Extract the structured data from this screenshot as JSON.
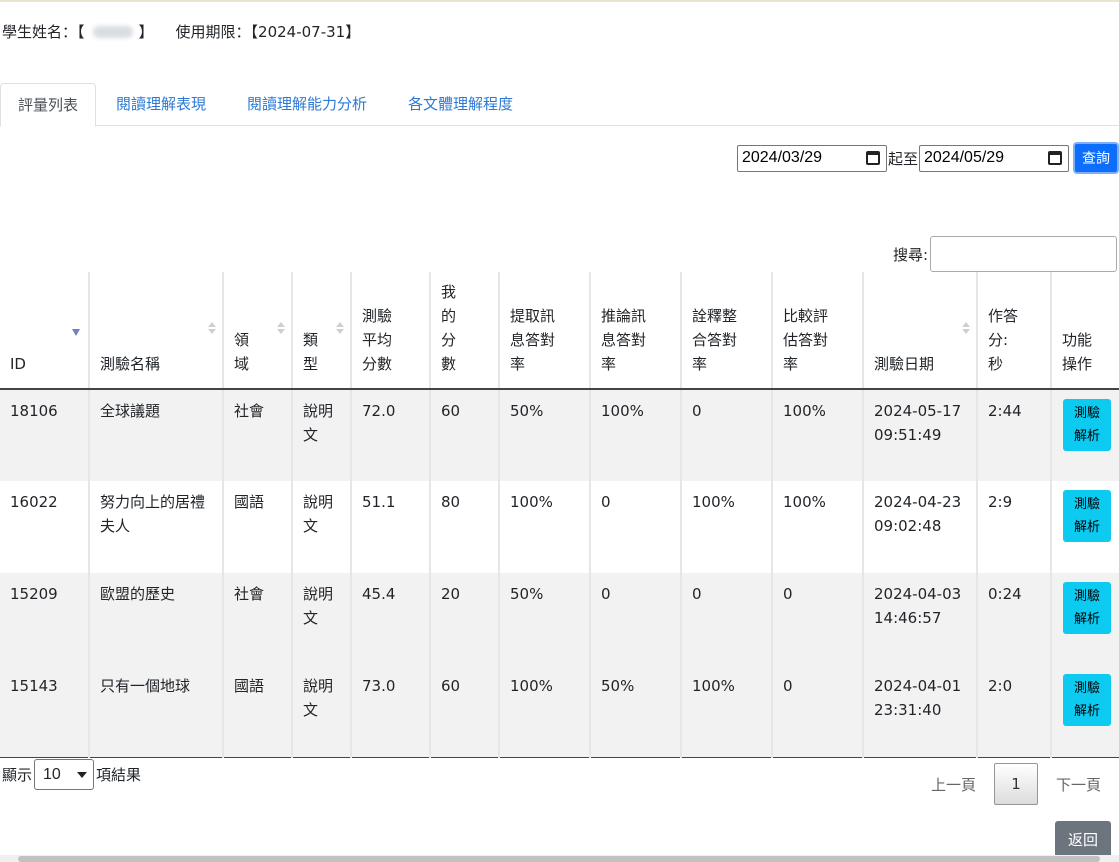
{
  "student": {
    "name_label": "學生姓名：【",
    "name_close": "】",
    "period_label": "使用期限：【2024-07-31】"
  },
  "tabs": [
    {
      "label": "評量列表",
      "active": true
    },
    {
      "label": "閱讀理解表現"
    },
    {
      "label": "閱讀理解能力分析"
    },
    {
      "label": "各文體理解程度"
    }
  ],
  "filter": {
    "start_date": "2024/03/29",
    "separator": "起至",
    "end_date": "2024/05/29",
    "query_label": "查詢"
  },
  "search": {
    "label": "搜尋:"
  },
  "table": {
    "headers": {
      "id": [
        "ID"
      ],
      "name": [
        "測驗名稱"
      ],
      "domain": [
        "領",
        "域"
      ],
      "type": [
        "類",
        "型"
      ],
      "avg": [
        "測驗",
        "平均",
        "分數"
      ],
      "my": [
        "我",
        "的",
        "分",
        "數"
      ],
      "extract": [
        "提取訊",
        "息答對",
        "率"
      ],
      "infer": [
        "推論訊",
        "息答對",
        "率"
      ],
      "interpret": [
        "詮釋整",
        "合答對",
        "率"
      ],
      "evaluate": [
        "比較評",
        "估答對",
        "率"
      ],
      "date": [
        "測驗日期"
      ],
      "time": [
        "作答",
        "分:",
        "秒"
      ],
      "action": [
        "功能",
        "操作"
      ]
    },
    "rows": [
      {
        "id": "18106",
        "name": [
          "全球議題"
        ],
        "domain": "社會",
        "type": [
          "說明",
          "文"
        ],
        "avg": "72.0",
        "my": "60",
        "extract": "50%",
        "infer": "100%",
        "interpret": "0",
        "evaluate": "100%",
        "date": [
          "2024-05-17",
          "09:51:49"
        ],
        "time": "2:44",
        "action": [
          "測驗",
          "解析"
        ]
      },
      {
        "id": "16022",
        "name": [
          "努力向上的居禮",
          "夫人"
        ],
        "domain": "國語",
        "type": [
          "說明",
          "文"
        ],
        "avg": "51.1",
        "my": "80",
        "extract": "100%",
        "infer": "0",
        "interpret": "100%",
        "evaluate": "100%",
        "date": [
          "2024-04-23",
          "09:02:48"
        ],
        "time": "2:9",
        "action": [
          "測驗",
          "解析"
        ]
      },
      {
        "id": "15209",
        "name": [
          "歐盟的歷史"
        ],
        "domain": "社會",
        "type": [
          "說明",
          "文"
        ],
        "avg": "45.4",
        "my": "20",
        "extract": "50%",
        "infer": "0",
        "interpret": "0",
        "evaluate": "0",
        "date": [
          "2024-04-03",
          "14:46:57"
        ],
        "time": "0:24",
        "action": [
          "測驗",
          "解析"
        ]
      },
      {
        "id": "15143",
        "name": [
          "只有一個地球"
        ],
        "domain": "國語",
        "type": [
          "說明",
          "文"
        ],
        "avg": "73.0",
        "my": "60",
        "extract": "100%",
        "infer": "50%",
        "interpret": "100%",
        "evaluate": "0",
        "date": [
          "2024-04-01",
          "23:31:40"
        ],
        "time": "2:0",
        "action": [
          "測驗",
          "解析"
        ]
      }
    ]
  },
  "length": {
    "prefix": "顯示",
    "value": "10",
    "suffix": "項結果"
  },
  "pager": {
    "prev": "上一頁",
    "current": "1",
    "next": "下一頁"
  },
  "back_label": "返回"
}
